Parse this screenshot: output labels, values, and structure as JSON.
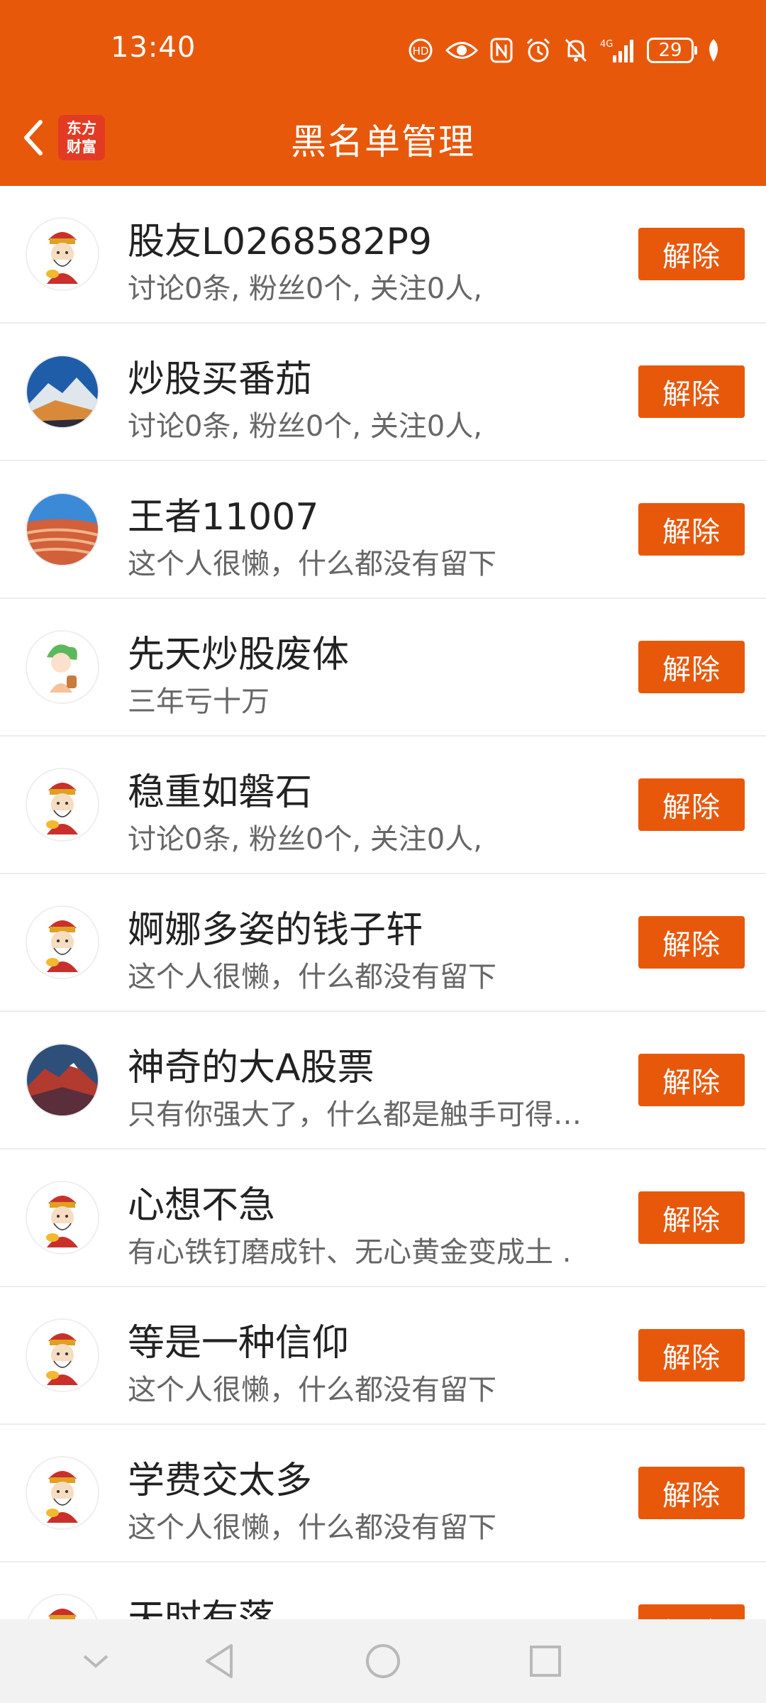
{
  "status_bar": {
    "time": "13:40",
    "battery": "29",
    "icons": [
      "hd-call-icon",
      "eye-icon",
      "nfc-icon",
      "alarm-icon",
      "mute-icon",
      "signal-4g-icon",
      "battery-icon",
      "leaf-icon"
    ]
  },
  "header": {
    "title": "黑名单管理",
    "logo_line1": "东方",
    "logo_line2": "财富",
    "back_icon": "back-arrow-icon"
  },
  "blacklist": [
    {
      "name": "股友L0268582P9",
      "bio": "讨论0条, 粉丝0个, 关注0人,",
      "action": "解除",
      "avatar": "caishen"
    },
    {
      "name": "炒股买番茄",
      "bio": "讨论0条, 粉丝0个, 关注0人,",
      "action": "解除",
      "avatar": "mountain"
    },
    {
      "name": "王者11007",
      "bio": "这个人很懒，什么都没有留下",
      "action": "解除",
      "avatar": "canyon"
    },
    {
      "name": "先天炒股废体",
      "bio": "三年亏十万",
      "action": "解除",
      "avatar": "anime"
    },
    {
      "name": "稳重如磐石",
      "bio": "讨论0条, 粉丝0个, 关注0人,",
      "action": "解除",
      "avatar": "caishen"
    },
    {
      "name": "婀娜多姿的钱子轩",
      "bio": "这个人很懒，什么都没有留下",
      "action": "解除",
      "avatar": "caishen"
    },
    {
      "name": "神奇的大A股票",
      "bio": "只有你强大了，什么都是触手可得…",
      "action": "解除",
      "avatar": "redmountain"
    },
    {
      "name": "心想不急",
      "bio": "有心铁钉磨成针、无心黄金变成土 .",
      "action": "解除",
      "avatar": "caishen"
    },
    {
      "name": "等是一种信仰",
      "bio": "这个人很懒，什么都没有留下",
      "action": "解除",
      "avatar": "caishen"
    },
    {
      "name": "学费交太多",
      "bio": "这个人很懒，什么都没有留下",
      "action": "解除",
      "avatar": "caishen"
    },
    {
      "name": "天时有落",
      "bio": "",
      "action": "解除",
      "avatar": "caishen"
    }
  ],
  "nav_bar": {
    "icons": [
      "collapse-chevron-icon",
      "back-triangle-icon",
      "home-circle-icon",
      "recents-square-icon"
    ]
  },
  "colors": {
    "accent": "#e8580b",
    "background": "#ffffff"
  }
}
